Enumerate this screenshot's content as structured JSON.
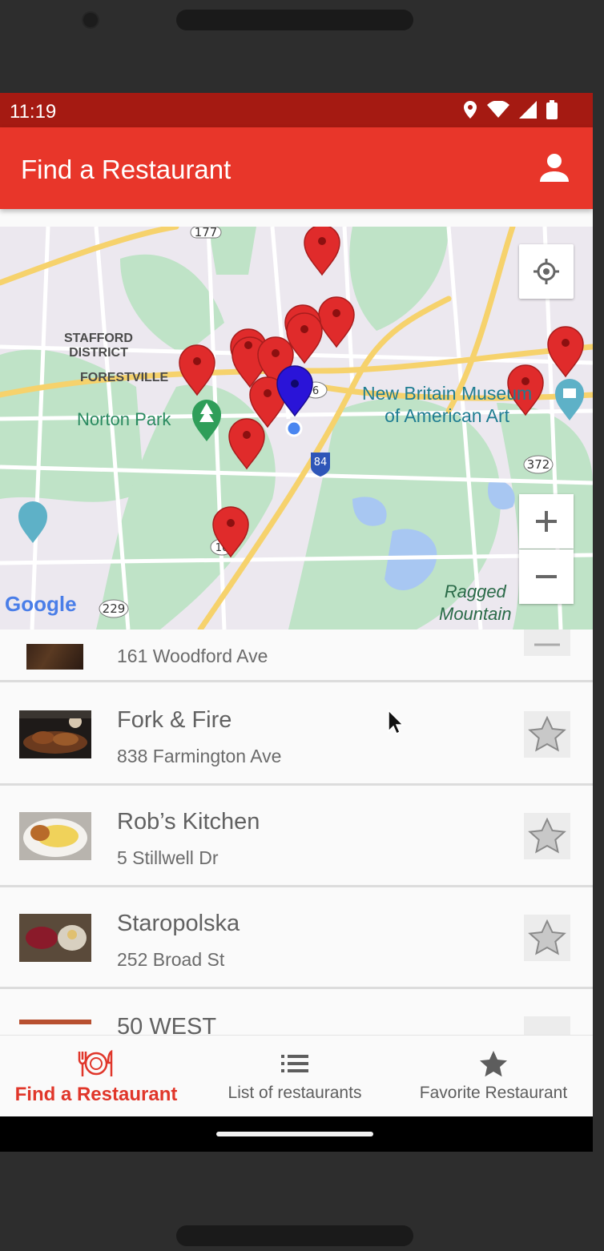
{
  "status_bar": {
    "time": "11:19"
  },
  "app_bar": {
    "title": "Find a Restaurant"
  },
  "map": {
    "labels": {
      "stafford": "STAFFORD\nDISTRICT",
      "forestville": "FORESTVILLE",
      "norton_park": "Norton Park",
      "museum": "New Britain Museum\nof American Art",
      "ragged": "Ragged\nMountain",
      "google": "Google",
      "route_177": "177",
      "route_372": "372",
      "route_229": "229",
      "route_84": "84",
      "route_6": "6",
      "route_10": "10"
    },
    "colors": {
      "pin": "#e02b2b",
      "user_pin": "#2a14d8",
      "park": "#bfe3c7",
      "water": "#a8c7f2",
      "highway": "#f6d26c"
    }
  },
  "list": {
    "items": [
      {
        "name": "",
        "address": "161 Woodford Ave"
      },
      {
        "name": "Fork & Fire",
        "address": "838 Farmington Ave"
      },
      {
        "name": "Rob’s Kitchen",
        "address": "5 Stillwell Dr"
      },
      {
        "name": "Staropolska",
        "address": "252 Broad St"
      },
      {
        "name": "50 WEST",
        "address": ""
      }
    ]
  },
  "bottom_nav": {
    "items": [
      {
        "label": "Find a Restaurant",
        "icon": "restaurant-icon",
        "active": true
      },
      {
        "label": "List of restaurants",
        "icon": "list-icon",
        "active": false
      },
      {
        "label": "Favorite Restaurant",
        "icon": "star-icon",
        "active": false
      }
    ],
    "colors": {
      "active": "#e0362a",
      "inactive": "#5d5d5d"
    }
  }
}
